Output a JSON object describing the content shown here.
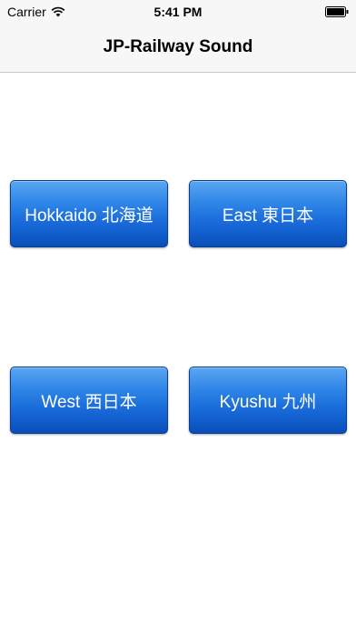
{
  "status_bar": {
    "carrier": "Carrier",
    "time": "5:41 PM",
    "icons": [
      "wifi-icon",
      "battery-icon"
    ]
  },
  "nav": {
    "title": "JP-Railway Sound"
  },
  "buttons": {
    "hokkaido": "Hokkaido 北海道",
    "east": "East 東日本",
    "west": "West 西日本",
    "kyushu": "Kyushu 九州"
  },
  "colors": {
    "button_top": "#5aa6f2",
    "button_bottom": "#0a4fb8",
    "button_text": "#ffffff",
    "bar_background": "#f7f7f7"
  }
}
